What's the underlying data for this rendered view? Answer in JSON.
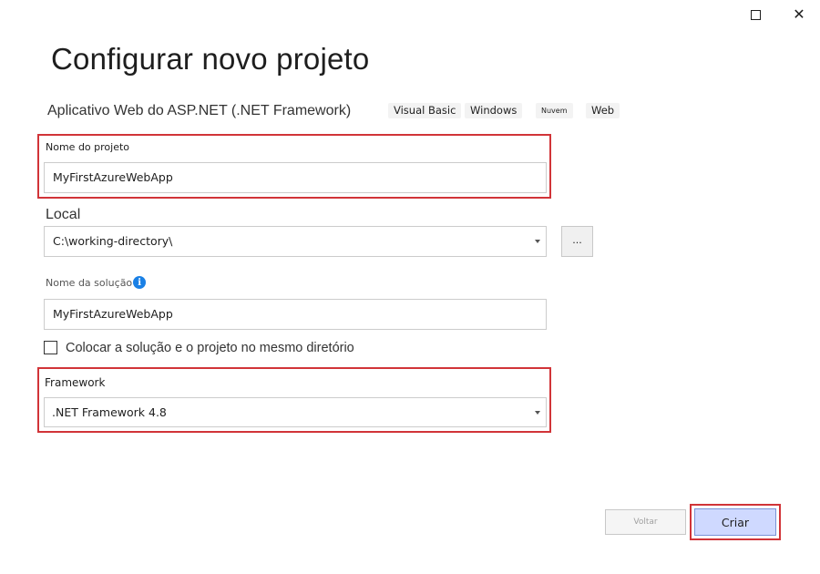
{
  "window": {
    "maximize_symbol": "",
    "close_symbol": "✕"
  },
  "header": {
    "title": "Configurar novo projeto",
    "template_name": "Aplicativo Web do ASP.NET (.NET Framework)",
    "tags": [
      "Visual Basic",
      "Windows",
      "Nuvem",
      "Web"
    ]
  },
  "form": {
    "project_name": {
      "label": "Nome do projeto",
      "value": "MyFirstAzureWebApp"
    },
    "location": {
      "label": "Local",
      "value": "C:\\working-directory\\",
      "browse_label": "..."
    },
    "solution_name": {
      "label": "Nome da solução",
      "value": "MyFirstAzureWebApp",
      "info_symbol": "i"
    },
    "same_directory": {
      "label": "Colocar a solução e o projeto no mesmo diretório",
      "checked": false
    },
    "framework": {
      "label": "Framework",
      "value": ".NET Framework 4.8"
    }
  },
  "footer": {
    "back_label": "Voltar",
    "create_label": "Criar"
  },
  "colors": {
    "highlight": "#d13438",
    "info_icon": "#1a80e5",
    "create_button": "#cfd9ff"
  }
}
